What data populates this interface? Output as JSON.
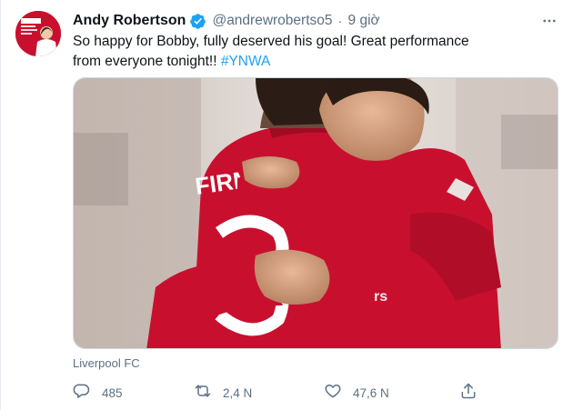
{
  "tweet": {
    "avatar_alt": "Andy Robertson avatar",
    "display_name": "Andy Robertson",
    "verified": true,
    "handle": "@andrewrobertso5",
    "separator": "·",
    "time": "9 giờ",
    "text": "So happy for Bobby, fully deserved his goal! Great performance from everyone tonight!! ",
    "hashtag": "#YNWA",
    "media_alt": "Two Liverpool players embracing on the pitch",
    "media_jersey_text": "FIRMI",
    "source_label": "Liverpool FC",
    "actions": {
      "reply_count": "485",
      "retweet_count": "2,4 N",
      "like_count": "47,6 N"
    },
    "colors": {
      "accent": "#1da1f2",
      "secondary_text": "#5b7083",
      "jersey_red": "#c8102e"
    }
  }
}
